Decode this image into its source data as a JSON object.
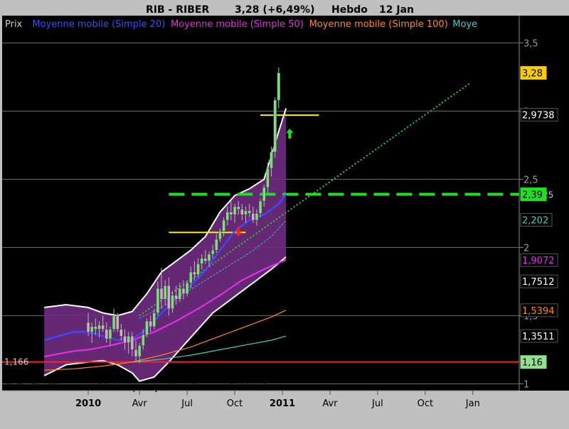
{
  "header": {
    "symbol": "RIB - RIBER",
    "price_change": "3,28 (+6,49%)",
    "period": "Hebdo",
    "date": "12 Jan"
  },
  "legend": [
    {
      "label": "Prix",
      "color": "#c8c8c8"
    },
    {
      "label": "Moyenne mobile (Simple 20)",
      "color": "#3a4dff"
    },
    {
      "label": "Moyenne mobile (Simple 50)",
      "color": "#e030e0"
    },
    {
      "label": "Moyenne mobile (Simple 100)",
      "color": "#ff8a1a"
    },
    {
      "label": "Moye",
      "color": "#40d0c0"
    }
  ],
  "footer": "© ProRealTime.com Historique ajusté suite aux dividendes",
  "colors": {
    "background": "#000000",
    "frame": "#c0c0c0",
    "bollinger_fill": "#6a2a7a",
    "candle_up": "#7ce07c",
    "candle_down": "#d0b0c8",
    "support_line": "#ff2020",
    "dashed_line": "#22dd22",
    "trendline": "#33cc33",
    "yellow": "#ffee00"
  },
  "chart_data": {
    "type": "candlestick",
    "y_axis": {
      "range": [
        0.95,
        3.7
      ],
      "ticks": [
        {
          "value": 1,
          "label": "1"
        },
        {
          "value": 1.5,
          "label": "1,5"
        },
        {
          "value": 2,
          "label": "2"
        },
        {
          "value": 2.5,
          "label": "2,5"
        },
        {
          "value": 3,
          "label": "3"
        },
        {
          "value": 3.5,
          "label": "3,5"
        }
      ]
    },
    "x_axis": {
      "ticks": [
        {
          "week": 0,
          "label": "2010",
          "bold": true
        },
        {
          "week": 14,
          "label": "Avr",
          "bold": false
        },
        {
          "week": 27,
          "label": "Jul",
          "bold": false
        },
        {
          "week": 40,
          "label": "Oct",
          "bold": false
        },
        {
          "week": 53,
          "label": "2011",
          "bold": true
        },
        {
          "week": 66,
          "label": "Avr",
          "bold": false
        },
        {
          "week": 79,
          "label": "Jul",
          "bold": false
        },
        {
          "week": 92,
          "label": "Oct",
          "bold": false
        },
        {
          "week": 105,
          "label": "Jan",
          "bold": false
        }
      ],
      "week_range": [
        -12,
        108
      ]
    },
    "price_labels": [
      {
        "value": 3.28,
        "label": "3,28",
        "bg": "#ffcc00",
        "fg": "#000000"
      },
      {
        "value": 2.9738,
        "label": "2,9738",
        "bg": "#000000",
        "fg": "#ffffff"
      },
      {
        "value": 2.39,
        "label": "2,39",
        "bg": "#22dd22",
        "fg": "#000000"
      },
      {
        "value": 2.202,
        "label": "2,202",
        "bg": "#000000",
        "fg": "#40d0c0"
      },
      {
        "value": 1.9072,
        "label": "1,9072",
        "bg": "#000000",
        "fg": "#e030e0"
      },
      {
        "value": 1.7512,
        "label": "1,7512",
        "bg": "#000000",
        "fg": "#ffffff"
      },
      {
        "value": 1.5394,
        "label": "1,5394",
        "bg": "#000000",
        "fg": "#ff8a1a"
      },
      {
        "value": 1.3511,
        "label": "1,3511",
        "bg": "#000000",
        "fg": "#ffffff"
      },
      {
        "value": 1.16,
        "label": "1,16",
        "bg": "#90e090",
        "fg": "#000000"
      }
    ],
    "annotations": [
      {
        "label": "1,166",
        "value": 1.166
      },
      {
        "label": "25",
        "value": 2.39
      }
    ],
    "horizontal_lines": [
      {
        "name": "support",
        "value": 1.16,
        "color": "#ff2020",
        "style": "solid"
      },
      {
        "name": "resistance-dashed",
        "value": 2.39,
        "color": "#22dd22",
        "style": "dashed",
        "from_week": 22
      },
      {
        "name": "yellow-top",
        "value": 2.97,
        "color": "#ffee00",
        "style": "solid",
        "from_week": 47,
        "to_week": 63
      },
      {
        "name": "yellow-base",
        "value": 2.11,
        "color": "#ffee00",
        "style": "solid",
        "from_week": 22,
        "to_week": 43
      }
    ],
    "trendline": {
      "from": {
        "week": 14,
        "value": 1.5
      },
      "to": {
        "week": 104,
        "value": 3.2
      }
    },
    "arrows": [
      {
        "direction": "up",
        "week": 55,
        "value": 2.83,
        "color": "#22dd22"
      },
      {
        "direction": "down",
        "week": 41,
        "value": 2.12,
        "color": "#ff2020"
      }
    ],
    "candles": [
      {
        "o": 1.45,
        "h": 1.52,
        "l": 1.35,
        "c": 1.38
      },
      {
        "o": 1.38,
        "h": 1.45,
        "l": 1.3,
        "c": 1.42
      },
      {
        "o": 1.42,
        "h": 1.48,
        "l": 1.36,
        "c": 1.4
      },
      {
        "o": 1.4,
        "h": 1.46,
        "l": 1.34,
        "c": 1.43
      },
      {
        "o": 1.43,
        "h": 1.5,
        "l": 1.38,
        "c": 1.4
      },
      {
        "o": 1.4,
        "h": 1.45,
        "l": 1.3,
        "c": 1.33
      },
      {
        "o": 1.33,
        "h": 1.42,
        "l": 1.28,
        "c": 1.4
      },
      {
        "o": 1.4,
        "h": 1.55,
        "l": 1.38,
        "c": 1.5
      },
      {
        "o": 1.5,
        "h": 1.52,
        "l": 1.38,
        "c": 1.4
      },
      {
        "o": 1.4,
        "h": 1.44,
        "l": 1.32,
        "c": 1.35
      },
      {
        "o": 1.35,
        "h": 1.4,
        "l": 1.25,
        "c": 1.3
      },
      {
        "o": 1.3,
        "h": 1.38,
        "l": 1.22,
        "c": 1.35
      },
      {
        "o": 1.35,
        "h": 1.38,
        "l": 1.2,
        "c": 1.25
      },
      {
        "o": 1.25,
        "h": 1.32,
        "l": 1.17,
        "c": 1.2
      },
      {
        "o": 1.2,
        "h": 1.3,
        "l": 1.15,
        "c": 1.28
      },
      {
        "o": 1.28,
        "h": 1.4,
        "l": 1.25,
        "c": 1.36
      },
      {
        "o": 1.36,
        "h": 1.48,
        "l": 1.34,
        "c": 1.46
      },
      {
        "o": 1.46,
        "h": 1.5,
        "l": 1.38,
        "c": 1.42
      },
      {
        "o": 1.42,
        "h": 1.55,
        "l": 1.4,
        "c": 1.52
      },
      {
        "o": 1.52,
        "h": 1.75,
        "l": 1.5,
        "c": 1.7
      },
      {
        "o": 1.7,
        "h": 1.85,
        "l": 1.55,
        "c": 1.62
      },
      {
        "o": 1.62,
        "h": 1.76,
        "l": 1.58,
        "c": 1.72
      },
      {
        "o": 1.72,
        "h": 1.78,
        "l": 1.5,
        "c": 1.55
      },
      {
        "o": 1.55,
        "h": 1.68,
        "l": 1.52,
        "c": 1.65
      },
      {
        "o": 1.65,
        "h": 1.72,
        "l": 1.58,
        "c": 1.62
      },
      {
        "o": 1.62,
        "h": 1.74,
        "l": 1.6,
        "c": 1.7
      },
      {
        "o": 1.7,
        "h": 1.76,
        "l": 1.62,
        "c": 1.66
      },
      {
        "o": 1.66,
        "h": 1.76,
        "l": 1.64,
        "c": 1.74
      },
      {
        "o": 1.74,
        "h": 1.86,
        "l": 1.7,
        "c": 1.82
      },
      {
        "o": 1.82,
        "h": 1.9,
        "l": 1.76,
        "c": 1.8
      },
      {
        "o": 1.8,
        "h": 1.92,
        "l": 1.78,
        "c": 1.88
      },
      {
        "o": 1.88,
        "h": 1.95,
        "l": 1.84,
        "c": 1.92
      },
      {
        "o": 1.92,
        "h": 1.98,
        "l": 1.88,
        "c": 1.9
      },
      {
        "o": 1.9,
        "h": 1.97,
        "l": 1.86,
        "c": 1.95
      },
      {
        "o": 1.95,
        "h": 2.02,
        "l": 1.92,
        "c": 1.98
      },
      {
        "o": 1.98,
        "h": 2.1,
        "l": 1.96,
        "c": 2.06
      },
      {
        "o": 2.06,
        "h": 2.14,
        "l": 2.04,
        "c": 2.12
      },
      {
        "o": 2.12,
        "h": 2.22,
        "l": 2.08,
        "c": 2.2
      },
      {
        "o": 2.2,
        "h": 2.3,
        "l": 2.16,
        "c": 2.26
      },
      {
        "o": 2.26,
        "h": 2.34,
        "l": 2.2,
        "c": 2.24
      },
      {
        "o": 2.24,
        "h": 2.32,
        "l": 2.18,
        "c": 2.3
      },
      {
        "o": 2.3,
        "h": 2.34,
        "l": 2.24,
        "c": 2.28
      },
      {
        "o": 2.28,
        "h": 2.32,
        "l": 2.2,
        "c": 2.24
      },
      {
        "o": 2.24,
        "h": 2.3,
        "l": 2.18,
        "c": 2.27
      },
      {
        "o": 2.27,
        "h": 2.32,
        "l": 2.22,
        "c": 2.25
      },
      {
        "o": 2.25,
        "h": 2.3,
        "l": 2.18,
        "c": 2.2
      },
      {
        "o": 2.2,
        "h": 2.28,
        "l": 2.16,
        "c": 2.25
      },
      {
        "o": 2.25,
        "h": 2.36,
        "l": 2.22,
        "c": 2.34
      },
      {
        "o": 2.34,
        "h": 2.46,
        "l": 2.3,
        "c": 2.44
      },
      {
        "o": 2.44,
        "h": 2.62,
        "l": 2.4,
        "c": 2.58
      },
      {
        "o": 2.58,
        "h": 2.74,
        "l": 2.52,
        "c": 2.7
      },
      {
        "o": 2.7,
        "h": 3.1,
        "l": 2.66,
        "c": 3.08
      },
      {
        "o": 3.08,
        "h": 3.32,
        "l": 3.02,
        "c": 3.28
      }
    ],
    "bollinger_upper": [
      [
        -12,
        1.56
      ],
      [
        -6,
        1.58
      ],
      [
        0,
        1.56
      ],
      [
        4,
        1.52
      ],
      [
        8,
        1.5
      ],
      [
        12,
        1.53
      ],
      [
        16,
        1.66
      ],
      [
        20,
        1.82
      ],
      [
        24,
        1.9
      ],
      [
        28,
        1.98
      ],
      [
        32,
        2.08
      ],
      [
        36,
        2.26
      ],
      [
        40,
        2.38
      ],
      [
        44,
        2.43
      ],
      [
        48,
        2.5
      ],
      [
        52,
        2.85
      ],
      [
        54,
        3.02
      ]
    ],
    "bollinger_lower": [
      [
        -12,
        1.06
      ],
      [
        -6,
        1.14
      ],
      [
        0,
        1.16
      ],
      [
        4,
        1.17
      ],
      [
        8,
        1.14
      ],
      [
        12,
        1.08
      ],
      [
        14,
        1.02
      ],
      [
        18,
        1.05
      ],
      [
        22,
        1.16
      ],
      [
        26,
        1.28
      ],
      [
        30,
        1.4
      ],
      [
        34,
        1.52
      ],
      [
        38,
        1.6
      ],
      [
        42,
        1.68
      ],
      [
        46,
        1.76
      ],
      [
        50,
        1.84
      ],
      [
        54,
        1.93
      ]
    ],
    "series": [
      {
        "name": "Moyenne mobile (Simple 20)",
        "color": "#3a4dff",
        "width": 2.2,
        "dash": "",
        "points": [
          [
            -12,
            1.32
          ],
          [
            -4,
            1.38
          ],
          [
            0,
            1.38
          ],
          [
            4,
            1.35
          ],
          [
            8,
            1.32
          ],
          [
            12,
            1.33
          ],
          [
            16,
            1.4
          ],
          [
            20,
            1.52
          ],
          [
            24,
            1.62
          ],
          [
            28,
            1.72
          ],
          [
            32,
            1.83
          ],
          [
            36,
            1.98
          ],
          [
            40,
            2.12
          ],
          [
            44,
            2.2
          ],
          [
            48,
            2.24
          ],
          [
            52,
            2.32
          ],
          [
            54,
            2.39
          ]
        ]
      },
      {
        "name": "Moyenne mobile (Simple 50)",
        "color": "#e030e0",
        "width": 2.2,
        "dash": "",
        "points": [
          [
            -12,
            1.2
          ],
          [
            -4,
            1.24
          ],
          [
            0,
            1.25
          ],
          [
            6,
            1.28
          ],
          [
            12,
            1.32
          ],
          [
            18,
            1.38
          ],
          [
            24,
            1.46
          ],
          [
            30,
            1.55
          ],
          [
            36,
            1.65
          ],
          [
            42,
            1.76
          ],
          [
            48,
            1.84
          ],
          [
            54,
            1.91
          ]
        ]
      },
      {
        "name": "Moyenne mobile (Simple 100)",
        "color": "#ff8a1a",
        "width": 1.2,
        "dash": "",
        "points": [
          [
            -12,
            1.1
          ],
          [
            -4,
            1.11
          ],
          [
            4,
            1.13
          ],
          [
            12,
            1.16
          ],
          [
            20,
            1.21
          ],
          [
            28,
            1.27
          ],
          [
            36,
            1.35
          ],
          [
            44,
            1.43
          ],
          [
            50,
            1.49
          ],
          [
            54,
            1.54
          ]
        ]
      },
      {
        "name": "Moye",
        "color": "#40d0c0",
        "width": 1.2,
        "dash": "",
        "points": [
          [
            12,
            1.16
          ],
          [
            20,
            1.18
          ],
          [
            28,
            1.21
          ],
          [
            36,
            1.25
          ],
          [
            44,
            1.29
          ],
          [
            50,
            1.32
          ],
          [
            54,
            1.35
          ]
        ]
      },
      {
        "name": "",
        "color": "#40b8d0",
        "width": 1,
        "dash": "3,2",
        "points": [
          [
            14,
            1.48
          ],
          [
            20,
            1.56
          ],
          [
            26,
            1.66
          ],
          [
            32,
            1.76
          ],
          [
            38,
            1.86
          ],
          [
            44,
            1.96
          ],
          [
            50,
            2.08
          ],
          [
            54,
            2.2
          ]
        ]
      }
    ]
  }
}
